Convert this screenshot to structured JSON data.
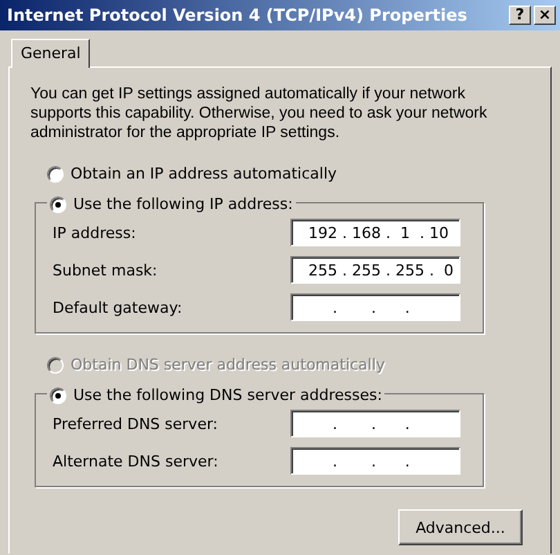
{
  "window": {
    "title": "Internet Protocol Version 4 (TCP/IPv4) Properties",
    "buttons": [
      {
        "kind": "help",
        "label": "?"
      },
      {
        "kind": "close",
        "label": "×"
      }
    ]
  },
  "tabs": [
    {
      "label": "General",
      "selected": true
    }
  ],
  "description": "You can get IP settings assigned automatically if your network supports this capability. Otherwise, you need to ask your network administrator for the appropriate IP settings.",
  "ip_section": {
    "options": [
      {
        "label": "Obtain an IP address automatically",
        "selected": false,
        "disabled": false
      },
      {
        "label": "Use the following IP address:",
        "selected": true,
        "disabled": false
      }
    ],
    "fields": [
      {
        "label": "IP address:",
        "value": "192 . 168 .  1  . 10"
      },
      {
        "label": "Subnet mask:",
        "value": "255 . 255 . 255 .  0"
      },
      {
        "label": "Default gateway:",
        "value": "     .       .      ."
      }
    ]
  },
  "dns_section": {
    "options": [
      {
        "label": "Obtain DNS server address automatically",
        "selected": false,
        "disabled": true
      },
      {
        "label": "Use the following DNS server addresses:",
        "selected": true,
        "disabled": false
      }
    ],
    "fields": [
      {
        "label": "Preferred DNS server:",
        "value": "     .       .      ."
      },
      {
        "label": "Alternate DNS server:",
        "value": "     .       .      ."
      }
    ]
  },
  "buttons": [
    "Advanced..."
  ]
}
